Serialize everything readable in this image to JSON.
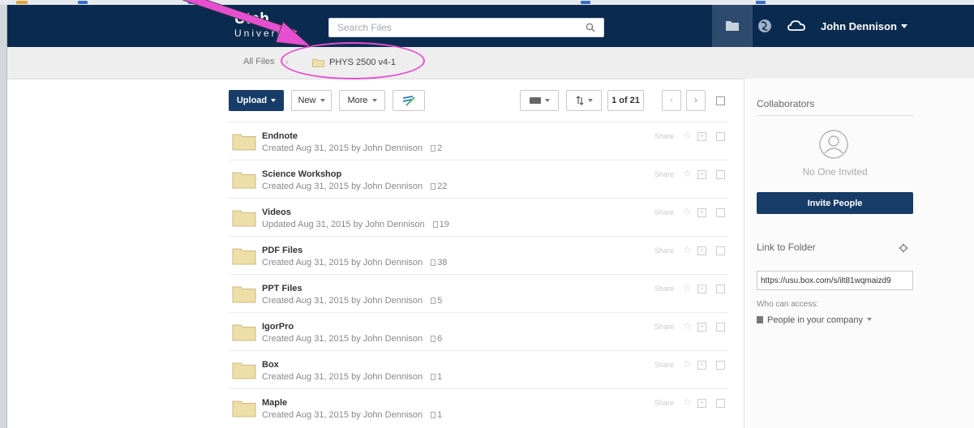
{
  "header": {
    "logo_main": "Utah",
    "logo_sub": "Univers",
    "search_placeholder": "Search Files",
    "user_name": "John Dennison"
  },
  "breadcrumb": {
    "root": "All Files",
    "separator": "‹",
    "current": "PHYS 2500 v4-1"
  },
  "toolbar": {
    "upload_label": "Upload",
    "new_label": "New",
    "more_label": "More",
    "page_indicator": "1 of 21",
    "prev_label": "‹",
    "next_label": "›"
  },
  "files": [
    {
      "name": "Endnote",
      "meta": "Created Aug 31, 2015 by John Dennison",
      "count": "2"
    },
    {
      "name": "Science Workshop",
      "meta": "Created Aug 31, 2015 by John Dennison",
      "count": "22"
    },
    {
      "name": "Videos",
      "meta": "Updated Aug 31, 2015 by John Dennison",
      "count": "19"
    },
    {
      "name": "PDF Files",
      "meta": "Created Aug 31, 2015 by John Dennison",
      "count": "38"
    },
    {
      "name": "PPT Files",
      "meta": "Created Aug 31, 2015 by John Dennison",
      "count": "5"
    },
    {
      "name": "IgorPro",
      "meta": "Created Aug 31, 2015 by John Dennison",
      "count": "6"
    },
    {
      "name": "Box",
      "meta": "Created Aug 31, 2015 by John Dennison",
      "count": "1"
    },
    {
      "name": "Maple",
      "meta": "Created Aug 31, 2015 by John Dennison",
      "count": "1"
    }
  ],
  "row_actions": {
    "share_label": "Share",
    "star_glyph": "☆",
    "add_glyph": "+"
  },
  "sidebar": {
    "collaborators_title": "Collaborators",
    "empty_text": "No One Invited",
    "invite_label": "Invite People",
    "link_title": "Link to Folder",
    "link_url": "https://usu.box.com/s/ilt81wqmaizd9",
    "who_label": "Who can access:",
    "access_value": "People in your company"
  },
  "colors": {
    "header_bg": "#0b2a4f",
    "primary_button": "#173c68",
    "annotation_pink": "#e64fd2",
    "folder_fill": "#eedfa8"
  }
}
